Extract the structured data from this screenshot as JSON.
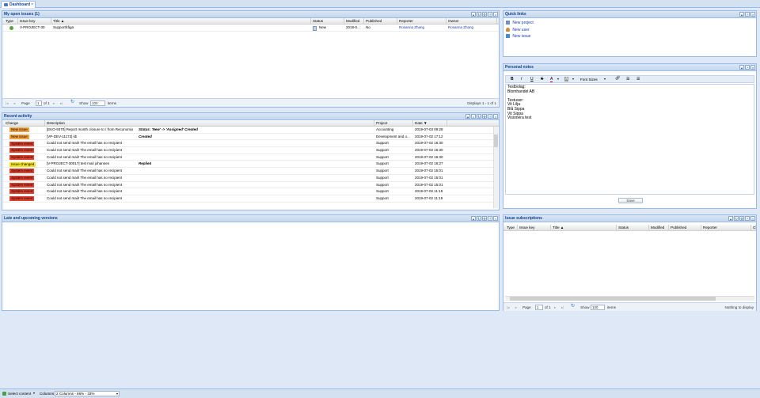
{
  "tab": {
    "label": "Dashboard",
    "close": "×"
  },
  "tools": {
    "pin": "▴",
    "refresh": "↻",
    "gear": "⚙",
    "help": "?",
    "close": "×"
  },
  "open_issues": {
    "title": "My open issues (1)",
    "columns": [
      "Type",
      "Issue key",
      "Title ▲",
      "Status",
      "Modified",
      "Published",
      "Reporter",
      "Owner"
    ],
    "rows": [
      {
        "key": "V-PROJECT-30",
        "title": "Supportfråga",
        "status": "New",
        "modified": "2019-0...",
        "published": "No",
        "reporter": "Rosanna Zhang",
        "owner": "Rosanna Zhang"
      }
    ],
    "pager": {
      "page_label": "Page",
      "page": "1",
      "of": "of 1",
      "show": "Show",
      "count": "100",
      "items": "items",
      "display": "Displays 1 - 1 of 1"
    }
  },
  "recent": {
    "title": "Recent activity",
    "columns": [
      "Change",
      "Description",
      "Project",
      "Date ▼"
    ],
    "rows": [
      {
        "change": "New issue",
        "kind": "ni",
        "desc": "[EKO-9370] Report month closure to / from Reconomix",
        "extra": "Status: 'New' -> 'Assigned'   Created",
        "project": "Accounting",
        "date": "2019-07-03 09:28"
      },
      {
        "change": "New issue",
        "kind": "ni",
        "desc": "[VP-DEV-11173] kb",
        "extra": "Created",
        "project": "Development and o...",
        "date": "2019-07-02 17:12"
      },
      {
        "change": "System event",
        "kind": "se",
        "desc": "Could not send mail! The email has no recipient",
        "extra": "",
        "project": "Support",
        "date": "2019-07-02 16:30"
      },
      {
        "change": "System event",
        "kind": "se",
        "desc": "Could not send mail! The email has no recipient",
        "extra": "",
        "project": "Support",
        "date": "2019-07-02 16:30"
      },
      {
        "change": "System event",
        "kind": "se",
        "desc": "Could not send mail! The email has no recipient",
        "extra": "",
        "project": "Support",
        "date": "2019-07-02 16:30"
      },
      {
        "change": "Issue changed",
        "kind": "ic",
        "desc": "[V-PROJECT-30017] test mail johannes",
        "extra": "Replied",
        "project": "Support",
        "date": "2019-07-02 16:27"
      },
      {
        "change": "System event",
        "kind": "se",
        "desc": "Could not send mail! The email has no recipient",
        "extra": "",
        "project": "Support",
        "date": "2019-07-02 15:01"
      },
      {
        "change": "System event",
        "kind": "se",
        "desc": "Could not send mail! The email has no recipient",
        "extra": "",
        "project": "Support",
        "date": "2019-07-02 15:01"
      },
      {
        "change": "System event",
        "kind": "se",
        "desc": "Could not send mail! The email has no recipient",
        "extra": "",
        "project": "Support",
        "date": "2019-07-02 15:01"
      },
      {
        "change": "System event",
        "kind": "se",
        "desc": "Could not send mail! The email has no recipient",
        "extra": "",
        "project": "Support",
        "date": "2019-07-02 11:19"
      },
      {
        "change": "System event",
        "kind": "se",
        "desc": "Could not send mail! The email has no recipient",
        "extra": "",
        "project": "Support",
        "date": "2019-07-02 11:19"
      }
    ]
  },
  "late": {
    "title": "Late and upcoming versions"
  },
  "quick": {
    "title": "Quick links",
    "links": [
      "New project",
      "New user",
      "New issue"
    ]
  },
  "notes": {
    "title": "Personal notes",
    "font_sizes": "Font Sizes",
    "text": "Testbolag:\nBlomhandel AB\n\nTestuser:\nVit Lilja\nBlå Sippa\nVit Sippa\nVisionera test",
    "save": "Save"
  },
  "subs": {
    "title": "Issue subscriptions",
    "columns": [
      "Type",
      "Issue key",
      "Title ▲",
      "Status",
      "Modified",
      "Published",
      "Reporter",
      "O"
    ],
    "pager": {
      "page_label": "Page",
      "page": "1",
      "of": "of 1",
      "show": "Show",
      "count": "100",
      "items": "items",
      "display": "Nothing to display"
    }
  },
  "bottom": {
    "select": "Select content",
    "columns_label": "Columns",
    "columns_value": "2 Columns - 66% - 33%"
  }
}
